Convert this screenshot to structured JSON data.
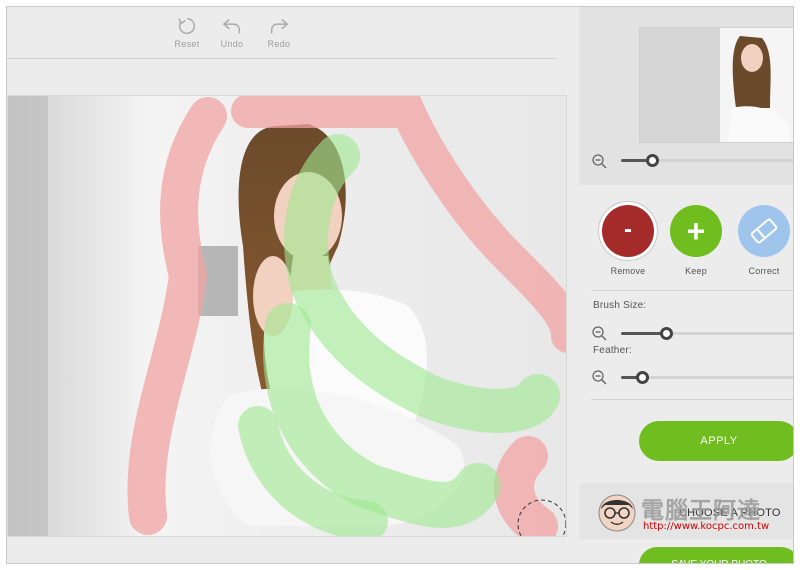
{
  "toolbar": {
    "reset_label": "Reset",
    "undo_label": "Undo",
    "redo_label": "Redo"
  },
  "right_panel": {
    "preview_zoom_level": 0.18,
    "modes": {
      "remove_label": "Remove",
      "remove_symbol": "-",
      "keep_label": "Keep",
      "keep_symbol": "+",
      "correct_label": "Correct"
    },
    "brush_size_label": "Brush Size:",
    "brush_size_level": 0.26,
    "feather_label": "Feather:",
    "feather_level": 0.12,
    "apply_label": "APPLY",
    "choose_photo_label": "CHOOSE A PHOTO",
    "save_photo_label": "SAVE YOUR PHOTO"
  },
  "watermark": {
    "brand": "電腦王阿達",
    "url": "http://www.kocpc.com.tw"
  },
  "colors": {
    "keep_green": "#6fbd1f",
    "remove_red": "#a52a2a",
    "correct_blue": "#9fc5ec",
    "remove_overlay": "#f2a3a3",
    "keep_overlay": "#9fe891"
  }
}
